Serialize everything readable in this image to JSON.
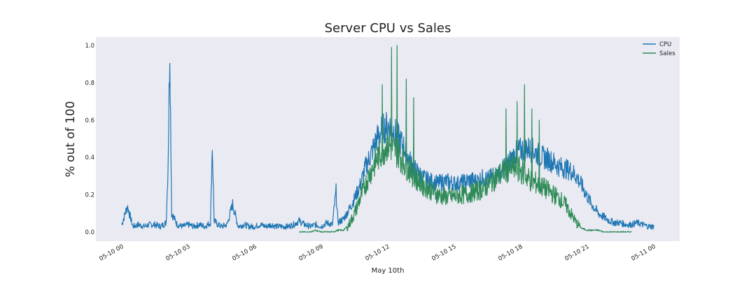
{
  "chart_data": {
    "type": "line",
    "title": "Server CPU vs Sales",
    "xlabel": "May 10th",
    "ylabel": "% out of 100",
    "xlim": [
      "05-10 00",
      "05-11 00"
    ],
    "ylim": [
      0,
      1.0
    ],
    "x_ticks": [
      "05-10 00",
      "05-10 03",
      "05-10 06",
      "05-10 09",
      "05-10 12",
      "05-10 15",
      "05-10 18",
      "05-10 21",
      "05-11 00"
    ],
    "y_ticks": [
      "0.0",
      "0.2",
      "0.4",
      "0.6",
      "0.8",
      "1.0"
    ],
    "grid": false,
    "legend_position": "top-right",
    "series": [
      {
        "name": "CPU",
        "color": "#1f77b4",
        "x": [
          "00:00",
          "00:15",
          "00:30",
          "00:45",
          "01:00",
          "01:15",
          "01:30",
          "01:45",
          "02:00",
          "02:05",
          "02:10",
          "02:15",
          "02:30",
          "02:45",
          "03:00",
          "03:15",
          "03:30",
          "03:45",
          "04:00",
          "04:05",
          "04:10",
          "04:20",
          "04:30",
          "04:45",
          "05:00",
          "05:15",
          "05:30",
          "05:45",
          "06:00",
          "06:15",
          "06:30",
          "06:45",
          "07:00",
          "07:15",
          "07:30",
          "07:45",
          "08:00",
          "08:15",
          "08:30",
          "08:45",
          "09:00",
          "09:15",
          "09:30",
          "09:40",
          "09:45",
          "10:00",
          "10:15",
          "10:30",
          "10:45",
          "11:00",
          "11:15",
          "11:30",
          "11:45",
          "12:00",
          "12:15",
          "12:30",
          "12:45",
          "13:00",
          "13:15",
          "13:30",
          "13:45",
          "14:00",
          "14:15",
          "14:30",
          "14:45",
          "15:00",
          "15:15",
          "15:30",
          "15:45",
          "16:00",
          "16:15",
          "16:30",
          "16:45",
          "17:00",
          "17:15",
          "17:30",
          "17:45",
          "18:00",
          "18:15",
          "18:30",
          "18:45",
          "19:00",
          "19:15",
          "19:30",
          "19:45",
          "20:00",
          "20:15",
          "20:30",
          "20:45",
          "21:00",
          "21:15",
          "21:30",
          "21:45",
          "22:00",
          "22:15",
          "22:30",
          "22:45",
          "23:00",
          "23:15",
          "23:30",
          "23:45",
          "24:00"
        ],
        "values": [
          0.04,
          0.14,
          0.03,
          0.04,
          0.03,
          0.04,
          0.04,
          0.03,
          0.05,
          0.34,
          1.0,
          0.1,
          0.04,
          0.03,
          0.04,
          0.03,
          0.04,
          0.03,
          0.05,
          0.47,
          0.06,
          0.04,
          0.03,
          0.04,
          0.15,
          0.03,
          0.04,
          0.03,
          0.03,
          0.04,
          0.03,
          0.04,
          0.03,
          0.03,
          0.03,
          0.04,
          0.06,
          0.04,
          0.03,
          0.04,
          0.03,
          0.05,
          0.04,
          0.22,
          0.05,
          0.07,
          0.12,
          0.18,
          0.25,
          0.35,
          0.42,
          0.5,
          0.55,
          0.57,
          0.55,
          0.5,
          0.45,
          0.38,
          0.33,
          0.3,
          0.28,
          0.27,
          0.26,
          0.27,
          0.27,
          0.26,
          0.26,
          0.27,
          0.28,
          0.27,
          0.29,
          0.28,
          0.3,
          0.31,
          0.34,
          0.38,
          0.42,
          0.44,
          0.45,
          0.44,
          0.42,
          0.4,
          0.39,
          0.37,
          0.35,
          0.34,
          0.33,
          0.3,
          0.25,
          0.19,
          0.14,
          0.1,
          0.08,
          0.06,
          0.05,
          0.05,
          0.04,
          0.04,
          0.05,
          0.04,
          0.03,
          0.03
        ]
      },
      {
        "name": "Sales",
        "color": "#2e8b57",
        "x": [
          "08:00",
          "08:15",
          "08:30",
          "08:45",
          "09:00",
          "09:15",
          "09:30",
          "09:45",
          "10:00",
          "10:15",
          "10:30",
          "10:45",
          "11:00",
          "11:15",
          "11:30",
          "11:45",
          "12:00",
          "12:15",
          "12:30",
          "12:45",
          "13:00",
          "13:15",
          "13:30",
          "13:45",
          "14:00",
          "14:15",
          "14:30",
          "14:45",
          "15:00",
          "15:15",
          "15:30",
          "15:45",
          "16:00",
          "16:15",
          "16:30",
          "16:45",
          "17:00",
          "17:15",
          "17:30",
          "17:45",
          "18:00",
          "18:15",
          "18:30",
          "18:45",
          "19:00",
          "19:15",
          "19:30",
          "19:45",
          "20:00",
          "20:15",
          "20:30",
          "20:45",
          "21:00",
          "21:15",
          "21:30",
          "21:45",
          "22:00",
          "22:15",
          "22:30",
          "22:45",
          "23:00"
        ],
        "values": [
          0.0,
          0.0,
          0.0,
          0.01,
          0.0,
          0.0,
          0.0,
          0.01,
          0.01,
          0.04,
          0.1,
          0.18,
          0.26,
          0.33,
          0.39,
          0.44,
          0.47,
          0.45,
          0.42,
          0.37,
          0.33,
          0.29,
          0.26,
          0.24,
          0.22,
          0.2,
          0.19,
          0.19,
          0.19,
          0.2,
          0.2,
          0.21,
          0.22,
          0.23,
          0.25,
          0.28,
          0.3,
          0.33,
          0.34,
          0.34,
          0.33,
          0.3,
          0.27,
          0.26,
          0.24,
          0.22,
          0.2,
          0.18,
          0.15,
          0.1,
          0.05,
          0.02,
          0.01,
          0.01,
          0.01,
          0.0,
          0.0,
          0.0,
          0.0,
          0.0,
          0.0
        ],
        "spikes": [
          {
            "x": "11:45",
            "value": 0.79
          },
          {
            "x": "12:10",
            "value": 0.99
          },
          {
            "x": "12:25",
            "value": 1.0
          },
          {
            "x": "12:50",
            "value": 0.82
          },
          {
            "x": "13:10",
            "value": 0.72
          },
          {
            "x": "17:20",
            "value": 0.66
          },
          {
            "x": "17:50",
            "value": 0.7
          },
          {
            "x": "18:10",
            "value": 0.79
          },
          {
            "x": "18:30",
            "value": 0.66
          },
          {
            "x": "18:50",
            "value": 0.6
          }
        ]
      }
    ]
  }
}
